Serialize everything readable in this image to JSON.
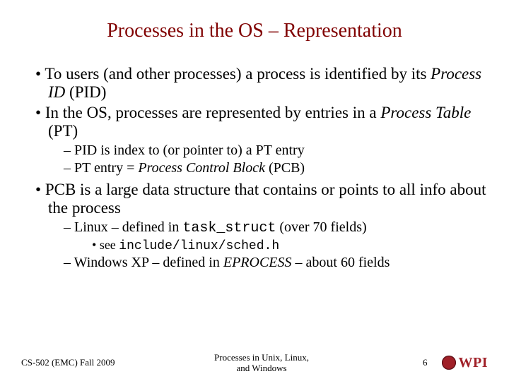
{
  "title": "Processes in the OS – Representation",
  "bullets": {
    "b1a_pre": "To users (and other processes) a process is identified by its ",
    "b1a_em": "Process ID",
    "b1a_post": " (PID)",
    "b1b_pre": "In the OS, processes are represented by entries in a ",
    "b1b_em": "Process Table",
    "b1b_post": " (PT)",
    "b2a": "PID is index to (or pointer to) a PT entry",
    "b2b_pre": "PT entry = ",
    "b2b_em": "Process Control Block",
    "b2b_post": " (PCB)",
    "b1c": "PCB is a large data structure that contains or points to all info about the process",
    "b2c_pre": "Linux – defined in ",
    "b2c_code": "task_struct",
    "b2c_post": " (over 70 fields)",
    "b3a_pre": "see ",
    "b3a_code": "include/linux/sched.h",
    "b2d_pre": "Windows XP – defined in ",
    "b2d_em": "EPROCESS",
    "b2d_post": " – about 60 fields"
  },
  "footer": {
    "left": "CS-502 (EMC) Fall 2009",
    "center_line1": "Processes in Unix, Linux,",
    "center_line2": "and Windows",
    "page": "6",
    "logo_text": "WPI"
  }
}
